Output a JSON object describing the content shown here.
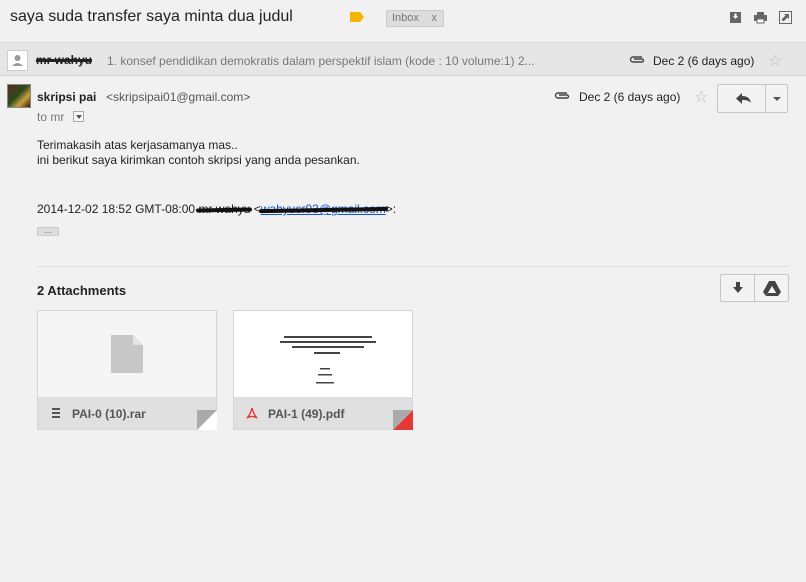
{
  "subject": "saya suda transfer saya minta dua judul",
  "inbox_label": "Inbox",
  "inbox_remove": "x",
  "colors": {
    "label_tag": "#f4b400",
    "link": "#1155cc",
    "pdf": "#e53935",
    "background": "#f1f1f1"
  },
  "collapsed": {
    "sender": "mr wahyu",
    "snippet": "1. konsef pendidikan demokratis dalam perspektif islam (kode : 10 volume:1) 2...",
    "date": "Dec 2 (6 days ago)"
  },
  "message": {
    "from_name": "skripsi pai",
    "from_email": "<skripsipai01@gmail.com>",
    "to": "to mr",
    "date": "Dec 2 (6 days ago)",
    "body": [
      "Terimakasih atas kerjasamanya mas..",
      "ini berikut saya kirimkan contoh skripsi yang anda pesankan."
    ],
    "quote_prefix": "2014-12-02 18:52 GMT-08:00 ",
    "quote_name": "mr wahyu",
    "quote_email": "wahyusr93@gmail.com",
    "quote_suffix": ">:",
    "expand": "..."
  },
  "attachments": {
    "title": "2 Attachments",
    "items": [
      {
        "name": "PAI-0 (10).rar",
        "icon": "archive-icon"
      },
      {
        "name": "PAI-1 (49).pdf",
        "icon": "pdf-icon"
      }
    ]
  },
  "icons": [
    "label-tag-icon",
    "download-all-icon",
    "print-icon",
    "new-window-icon",
    "attachment-icon",
    "star-icon",
    "reply-icon",
    "dropdown-icon",
    "save-to-drive-icon"
  ]
}
